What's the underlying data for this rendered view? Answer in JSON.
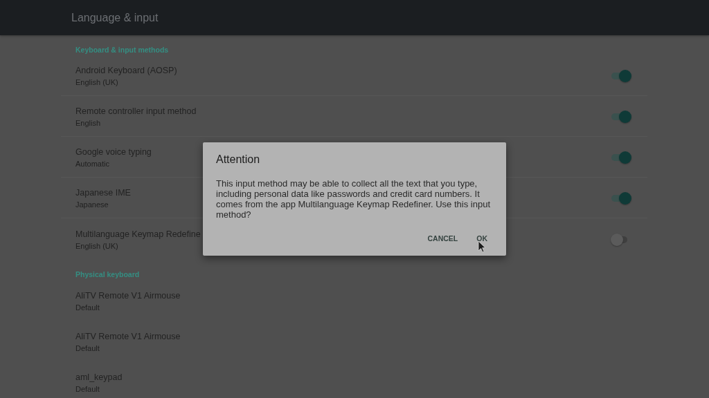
{
  "app_bar": {
    "title": "Language & input"
  },
  "sections": [
    {
      "kind": "toggles",
      "header": "Keyboard & input methods",
      "items": [
        {
          "title": "Android Keyboard (AOSP)",
          "subtitle": "English (UK)",
          "on": true
        },
        {
          "title": "Remote controller input method",
          "subtitle": "English",
          "on": true
        },
        {
          "title": "Google voice typing",
          "subtitle": "Automatic",
          "on": true
        },
        {
          "title": "Japanese IME",
          "subtitle": "Japanese",
          "on": true
        },
        {
          "title": "Multilanguage Keymap Redefine",
          "subtitle": "English (UK)",
          "on": false
        }
      ]
    },
    {
      "kind": "devices",
      "header": "Physical keyboard",
      "items": [
        {
          "title": "AliTV Remote V1 Airmouse",
          "subtitle": "Default"
        },
        {
          "title": "AliTV Remote V1 Airmouse",
          "subtitle": "Default"
        },
        {
          "title": "aml_keypad",
          "subtitle": "Default"
        }
      ]
    }
  ],
  "dialog": {
    "title": "Attention",
    "message": "This input method may be able to collect all the text that you type, including personal data like passwords and credit card numbers. It comes from the app Multilanguage Keymap Redefiner. Use this input method?",
    "buttons": [
      "CANCEL",
      "OK"
    ]
  }
}
